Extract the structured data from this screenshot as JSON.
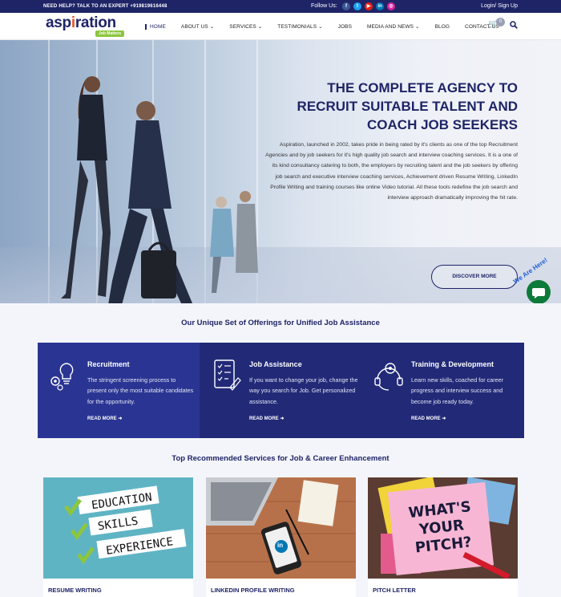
{
  "topbar": {
    "help": "NEED HELP? TALK TO AN EXPERT  +919819616448",
    "follow": "Follow Us:",
    "socials": [
      {
        "name": "facebook-icon",
        "glyph": "f",
        "color": "#3b5998"
      },
      {
        "name": "twitter-icon",
        "glyph": "t",
        "color": "#1da1f2"
      },
      {
        "name": "youtube-icon",
        "glyph": "▶",
        "color": "#e62117"
      },
      {
        "name": "linkedin-icon",
        "glyph": "in",
        "color": "#0077b5"
      },
      {
        "name": "instagram-icon",
        "glyph": "◎",
        "color": "#d6249f"
      }
    ],
    "login": "Login/ Sign Up"
  },
  "header": {
    "logo_word_a": "asp",
    "logo_word_accent": "i",
    "logo_word_b": "ration",
    "logo_tag": "Job Matters",
    "nav": [
      "HOME",
      "ABOUT US ⌄",
      "SERVICES ⌄",
      "TESTIMONIALS ⌄",
      "JOBS",
      "MEDIA AND NEWS ⌄",
      "BLOG",
      "CONTACT US"
    ],
    "cart_count": "0"
  },
  "hero": {
    "title": "THE COMPLETE AGENCY TO RECRUIT SUITABLE TALENT AND COACH JOB SEEKERS",
    "text": "Aspiration, launched in 2002, takes pride in being rated by it's clients as one of the top Recruitment Agencies and by job seekers for it's high quality job search and interview coaching services. It is a one of its kind consultancy catering to both, the employers by recruiting talent and the job seekers by offering job search and executive interview coaching services, Achievement driven Resume Writing, LinkedIn Profile Writing and training courses like online Video tutorial. All these tools redefine the job search and interview approach dramatically improving the hit rate.",
    "button": "DISCOVER MORE",
    "chat_tag": "We Are Here!"
  },
  "offerings": {
    "title": "Our Unique Set of Offerings for Unified Job Assistance",
    "items": [
      {
        "title": "Recruitment",
        "text": "The stringent screening process to present only the most suitable candidates for the opportunity.",
        "more": "READ MORE  ➜",
        "bg": "#2a3593"
      },
      {
        "title": "Job Assistance",
        "text": "If you want to change your job, change the way you search for Job. Get personalized assistance.",
        "more": "READ MORE  ➜",
        "bg": "#222a78"
      },
      {
        "title": "Training & Development",
        "text": "Learn new skills, coached for career progress and interview success and become job ready today.",
        "more": "READ MORE  ➜",
        "bg": "#222a78"
      }
    ]
  },
  "services": {
    "title": "Top Recommended Services for Job & Career Enhancement",
    "cards": [
      {
        "title": "RESUME WRITING",
        "words": [
          "EDUCATION",
          "SKILLS",
          "EXPERIENCE"
        ]
      },
      {
        "title": "LINKEDIN PROFILE WRITING",
        "badge": "in"
      },
      {
        "title": "PITCH LETTER",
        "note": "WHAT'S YOUR PITCH?"
      }
    ]
  }
}
